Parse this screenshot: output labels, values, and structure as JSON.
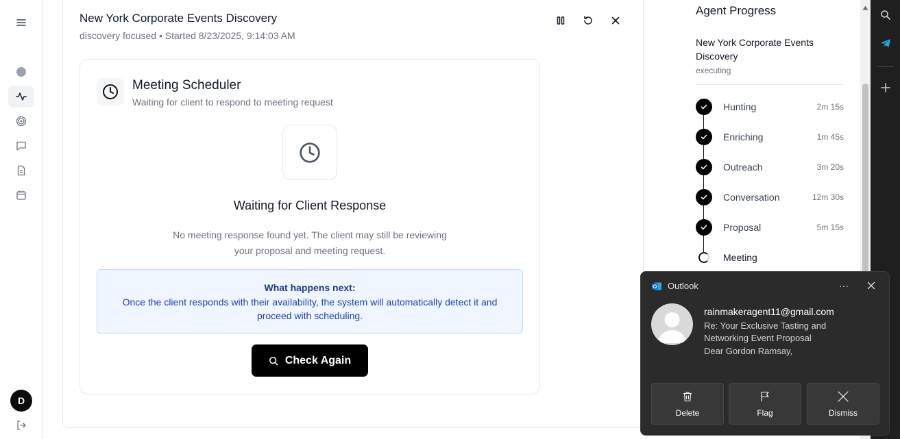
{
  "header": {
    "title": "New York Corporate Events Discovery",
    "subtitle": "discovery focused • Started 8/23/2025, 9:14:03 AM"
  },
  "scheduler": {
    "title": "Meeting Scheduler",
    "subtitle": "Waiting for client to respond to meeting request",
    "wait_title": "Waiting for Client Response",
    "wait_desc": "No meeting response found yet. The client may still be reviewing your proposal and meeting request.",
    "info_title": "What happens next:",
    "info_text": "Once the client responds with their availability, the system will automatically detect it and proceed with scheduling.",
    "check_label": "Check Again"
  },
  "progress": {
    "title": "Agent Progress",
    "task": "New York Corporate Events Discovery",
    "status": "executing",
    "steps": [
      {
        "label": "Hunting",
        "time": "2m 15s"
      },
      {
        "label": "Enriching",
        "time": "1m 45s"
      },
      {
        "label": "Outreach",
        "time": "3m 20s"
      },
      {
        "label": "Conversation",
        "time": "12m 30s"
      },
      {
        "label": "Proposal",
        "time": "5m 15s"
      },
      {
        "label": "Meeting",
        "time": ""
      }
    ]
  },
  "user": {
    "initial": "D"
  },
  "toast": {
    "app": "Outlook",
    "more": "···",
    "from": "rainmakeragent11@gmail.com",
    "subject_line1": "Re: Your Exclusive Tasting and",
    "subject_line2": "Networking Event Proposal",
    "preview": "Dear Gordon Ramsay,",
    "buttons": {
      "delete": "Delete",
      "flag": "Flag",
      "dismiss": "Dismiss"
    }
  },
  "icons": {
    "menu": "menu-icon",
    "dot": "status-dot-icon",
    "activity": "activity-icon",
    "target": "target-icon",
    "chat": "chat-icon",
    "document": "document-icon",
    "calendar": "calendar-icon",
    "logout": "logout-icon",
    "clock": "clock-icon",
    "pause": "pause-icon",
    "refresh": "refresh-icon",
    "close": "close-icon",
    "search": "search-icon",
    "check": "check-icon",
    "telegram": "telegram-icon",
    "plus": "plus-icon",
    "trash": "trash-icon",
    "flag": "flag-icon"
  },
  "colors": {
    "accent": "#000000",
    "info_bg": "#eff6ff",
    "info_border": "#bfdbfe",
    "info_text": "#1e40af",
    "toast_bg": "#2b2b2b"
  }
}
